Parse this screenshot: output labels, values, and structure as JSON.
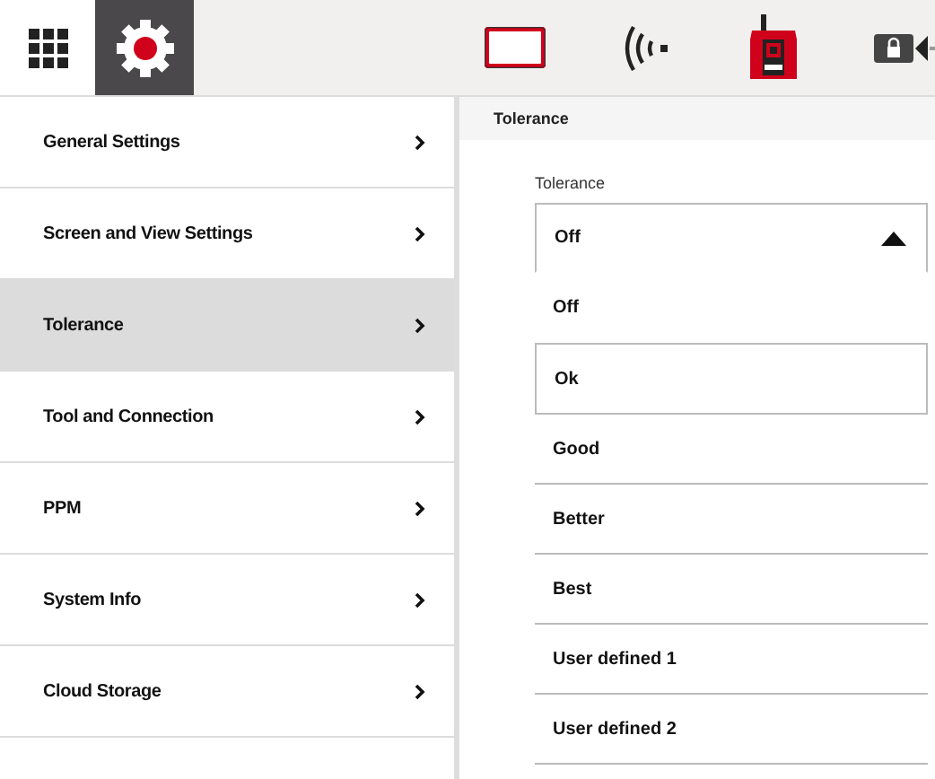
{
  "top_tabs": [
    {
      "kind": "apps",
      "selected": false
    },
    {
      "kind": "settings",
      "selected": true
    }
  ],
  "status_icons": [
    {
      "kind": "screen"
    },
    {
      "kind": "signal"
    },
    {
      "kind": "device"
    },
    {
      "kind": "camera"
    }
  ],
  "sidebar": {
    "items": [
      {
        "label": "General Settings",
        "selected": false
      },
      {
        "label": "Screen and View Settings",
        "selected": false
      },
      {
        "label": "Tolerance",
        "selected": true
      },
      {
        "label": "Tool and Connection",
        "selected": false
      },
      {
        "label": "PPM",
        "selected": false
      },
      {
        "label": "System Info",
        "selected": false
      },
      {
        "label": "Cloud Storage",
        "selected": false
      }
    ]
  },
  "panel": {
    "title": "Tolerance",
    "field_label": "Tolerance",
    "dropdown": {
      "value": "Off",
      "expanded": true,
      "options": [
        {
          "label": "Off",
          "highlighted": false
        },
        {
          "label": "Ok",
          "highlighted": true
        },
        {
          "label": "Good",
          "highlighted": false
        },
        {
          "label": "Better",
          "highlighted": false
        },
        {
          "label": "Best",
          "highlighted": false
        },
        {
          "label": "User defined 1",
          "highlighted": false
        },
        {
          "label": "User defined 2",
          "highlighted": false
        }
      ]
    }
  }
}
